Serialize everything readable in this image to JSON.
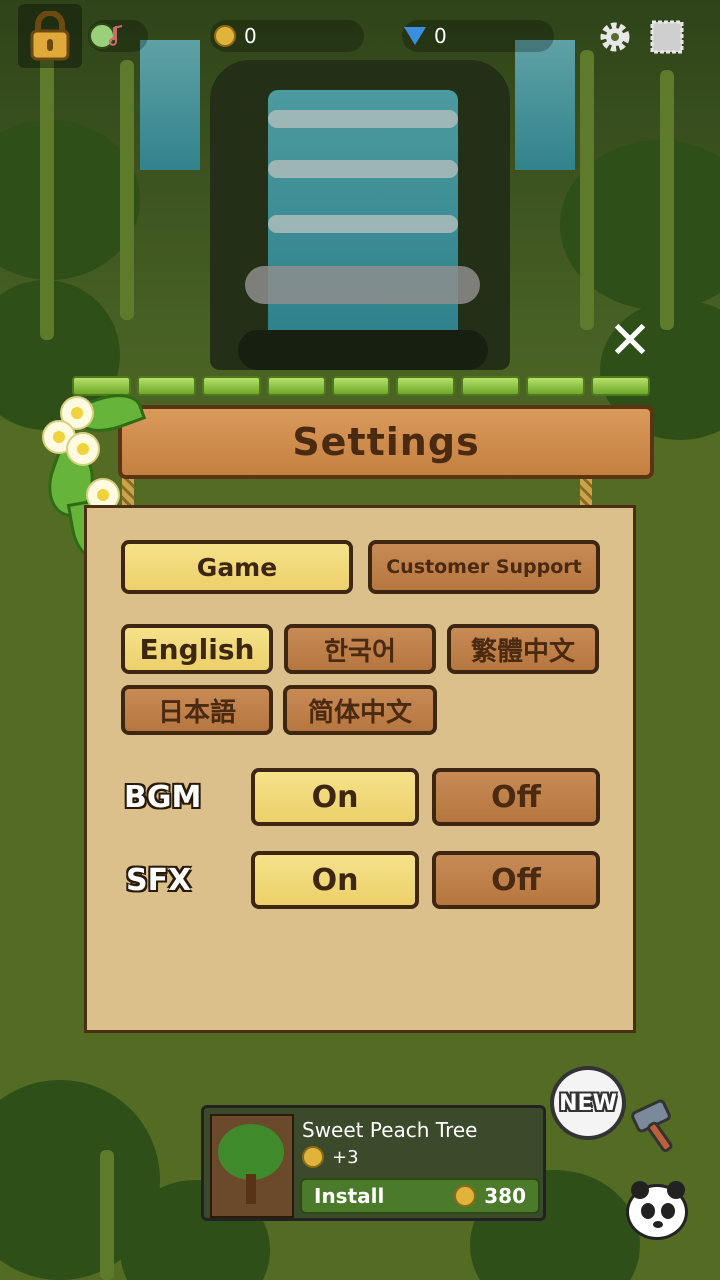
{
  "hud": {
    "coins": "0",
    "gems": "0"
  },
  "dialog": {
    "title": "Settings",
    "close_label": "✕",
    "tabs": [
      {
        "label": "Game",
        "selected": true
      },
      {
        "label": "Customer Support",
        "selected": false
      }
    ],
    "languages": [
      {
        "label": "English",
        "selected": true
      },
      {
        "label": "한국어",
        "selected": false
      },
      {
        "label": "繁體中文",
        "selected": false
      },
      {
        "label": "日本語",
        "selected": false
      },
      {
        "label": "简体中文",
        "selected": false
      }
    ],
    "bgm": {
      "label": "BGM",
      "on": "On",
      "off": "Off",
      "value": "On"
    },
    "sfx": {
      "label": "SFX",
      "on": "On",
      "off": "Off",
      "value": "On"
    }
  },
  "shop": {
    "item_name": "Sweet Peach Tree",
    "reward": "+3",
    "install_label": "Install",
    "price": "380"
  },
  "new_badge": "NEW",
  "colors": {
    "selected": "#f0d878",
    "unselected": "#c1824a",
    "wood": "#cf8c4c",
    "panel": "#dcc08c"
  }
}
